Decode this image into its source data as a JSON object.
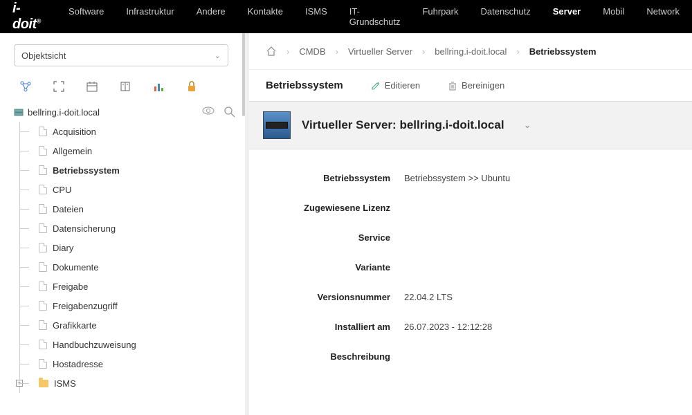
{
  "brand": "i-doit",
  "nav": {
    "items": [
      "Software",
      "Infrastruktur",
      "Andere",
      "Kontakte",
      "ISMS",
      "IT-Grundschutz",
      "Fuhrpark",
      "Datenschutz",
      "Server",
      "Mobil",
      "Network"
    ],
    "activeIndex": 8
  },
  "sidebar": {
    "selector": "Objektsicht",
    "root": "bellring.i-doit.local",
    "items": [
      {
        "label": "Acquisition"
      },
      {
        "label": "Allgemein"
      },
      {
        "label": "Betriebssystem",
        "selected": true
      },
      {
        "label": "CPU"
      },
      {
        "label": "Dateien"
      },
      {
        "label": "Datensicherung"
      },
      {
        "label": "Diary"
      },
      {
        "label": "Dokumente"
      },
      {
        "label": "Freigabe"
      },
      {
        "label": "Freigabenzugriff"
      },
      {
        "label": "Grafikkarte"
      },
      {
        "label": "Handbuchzuweisung"
      },
      {
        "label": "Hostadresse"
      },
      {
        "label": "ISMS",
        "folder": true,
        "expander": "+"
      }
    ]
  },
  "crumbs": [
    "CMDB",
    "Virtueller Server",
    "bellring.i-doit.local",
    "Betriebssystem"
  ],
  "section": {
    "title": "Betriebssystem",
    "edit": "Editieren",
    "clean": "Bereinigen"
  },
  "banner": {
    "prefix": "Virtueller Server: ",
    "name": "bellring.i-doit.local"
  },
  "details": [
    {
      "label": "Betriebssystem",
      "value": "Betriebssystem >> Ubuntu"
    },
    {
      "label": "Zugewiesene Lizenz",
      "value": ""
    },
    {
      "label": "Service",
      "value": ""
    },
    {
      "label": "Variante",
      "value": ""
    },
    {
      "label": "Versionsnummer",
      "value": "22.04.2 LTS"
    },
    {
      "label": "Installiert am",
      "value": "26.07.2023 - 12:12:28"
    },
    {
      "label": "Beschreibung",
      "value": ""
    }
  ]
}
